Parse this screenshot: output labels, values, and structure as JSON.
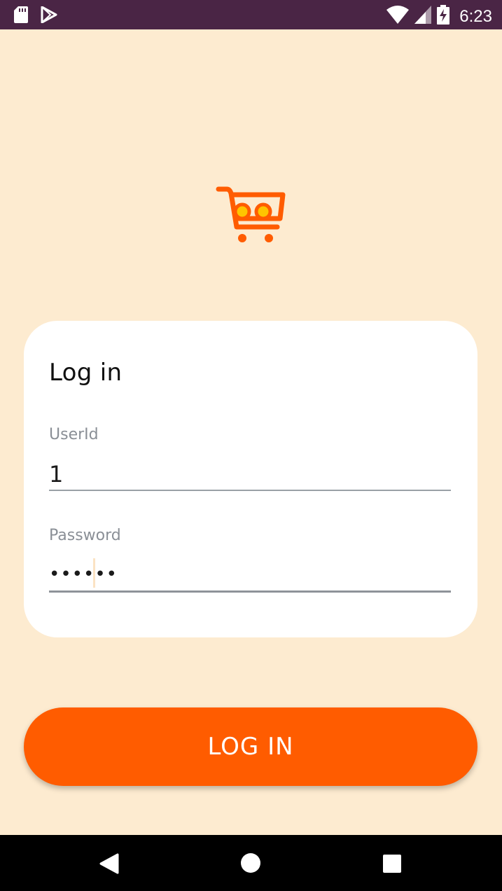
{
  "status_bar": {
    "time": "6:23",
    "left_icons": [
      "sd-card-icon",
      "play-store-icon"
    ],
    "right_icons": [
      "wifi-icon",
      "signal-icon",
      "battery-charging-icon"
    ]
  },
  "logo": {
    "icon": "shopping-cart-logo-icon",
    "colors": {
      "cart": "#ff5c00",
      "items": "#ffc400"
    }
  },
  "login_card": {
    "title": "Log in",
    "userid": {
      "label": "UserId",
      "value": "1"
    },
    "password": {
      "label": "Password",
      "value": "••••••"
    }
  },
  "login_button": {
    "label": "LOG IN"
  },
  "nav_bar": {
    "icons": [
      "back-icon",
      "home-icon",
      "recents-icon"
    ]
  },
  "colors": {
    "background": "#fdebd0",
    "status_bar": "#4a2545",
    "accent": "#ff5c00",
    "card": "#ffffff"
  }
}
